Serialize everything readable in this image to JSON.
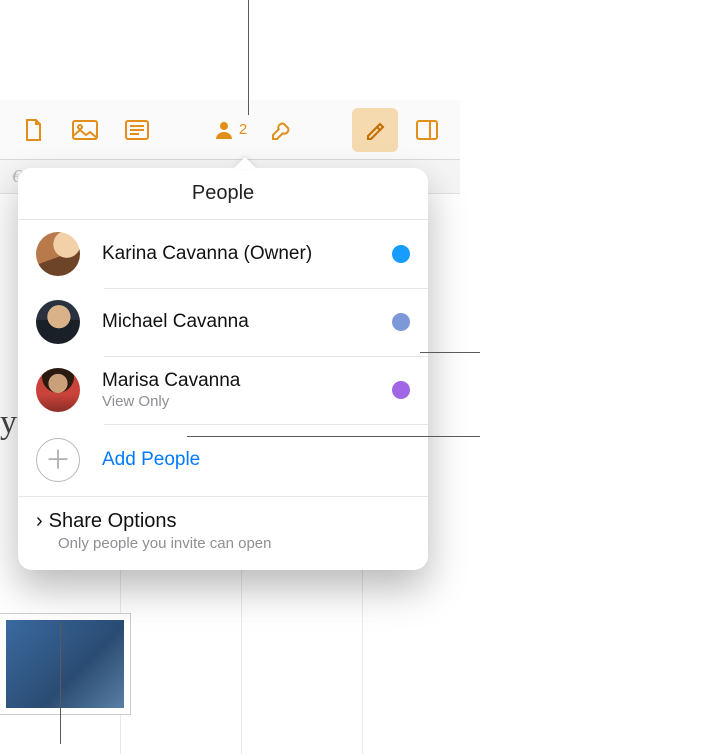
{
  "toolbar": {
    "accent": "#e28f1a",
    "collab_count": "2"
  },
  "popover": {
    "title": "People",
    "people": [
      {
        "name": "Karina Cavanna (Owner)",
        "sub": "",
        "dot": "#179dff"
      },
      {
        "name": "Michael Cavanna",
        "sub": "",
        "dot": "#7c98d8"
      },
      {
        "name": "Marisa Cavanna",
        "sub": "View Only",
        "dot": "#a066e6"
      }
    ],
    "add_label": "Add People",
    "share": {
      "title": "Share Options",
      "sub": "Only people you invite can open"
    }
  },
  "background": {
    "script_text": "y",
    "secondbar_glyph": "€"
  }
}
